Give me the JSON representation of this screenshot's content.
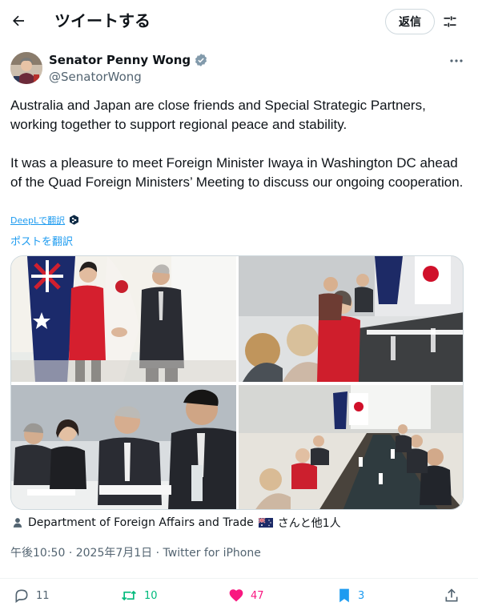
{
  "header": {
    "title": "ツイートする",
    "reply_label": "返信"
  },
  "author": {
    "name": "Senator Penny Wong",
    "handle": "@SenatorWong",
    "verified": true
  },
  "tweet": {
    "paragraph1": "Australia and Japan are close friends and Special Strategic Partners, working together to support regional peace and stability.",
    "paragraph2": "It was a pleasure to meet Foreign Minister Iwaya in Washington DC ahead of the Quad Foreign Ministers’ Meeting to discuss our ongoing cooperation."
  },
  "translate": {
    "deepl_label": "DeepLで翻訳",
    "translate_post_label": "ポストを翻訳"
  },
  "tagged": {
    "primary": "Department of Foreign Affairs and Trade",
    "others": "さんと他1人"
  },
  "meta": {
    "time": "午後10:50",
    "date": "2025年7月1日",
    "source": "Twitter for iPhone",
    "separator": "·"
  },
  "actions": {
    "replies": "11",
    "retweets": "10",
    "likes": "47",
    "bookmarks": "3"
  },
  "colors": {
    "accent": "#1d9bf0",
    "retweet": "#00ba7c",
    "like": "#f91880",
    "text": "#0f1419",
    "muted": "#536471"
  },
  "icons": [
    "back-arrow-icon",
    "settings-sliders-icon",
    "verified-badge-icon",
    "more-dots-icon",
    "deepl-icon",
    "person-icon",
    "australia-flag-icon",
    "reply-icon",
    "retweet-icon",
    "heart-icon",
    "bookmark-icon",
    "share-icon"
  ]
}
